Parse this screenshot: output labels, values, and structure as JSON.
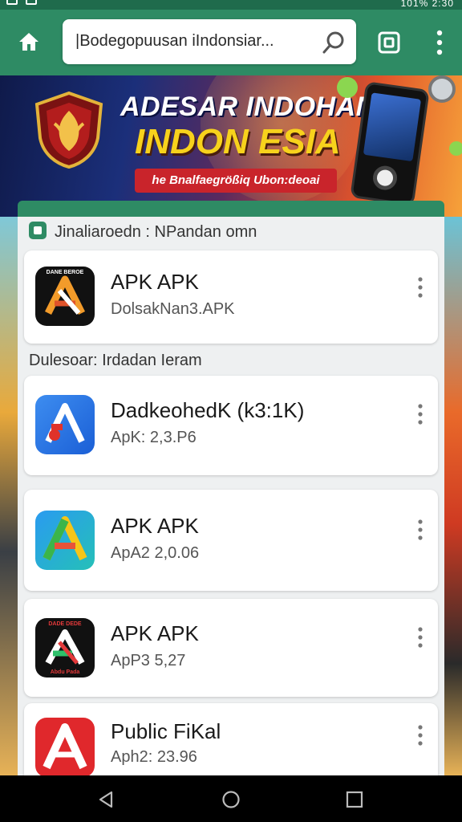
{
  "status_bar": {
    "right_text": "101% 2:30"
  },
  "browser": {
    "url_text": "|Bodegopuusan iIndonsiar..."
  },
  "banner": {
    "title_line1": "ADESAR INDOHAN",
    "title_line2": "INDON ESIA",
    "subtitle": "he Bnalfaegrößiq Ubon:deoai"
  },
  "sections": [
    {
      "title": "Jinaliaroedn :  NPandan omn"
    },
    {
      "title": "Dulesoar: Irdadan Ieram"
    }
  ],
  "apps": [
    {
      "name": "APK APK",
      "meta": "DolsakNan3.APK",
      "icon": "dark-apk-logo-icon"
    },
    {
      "name": "DadkeohedK (k3:1K)",
      "meta": "ApK: 2,3.P6",
      "icon": "blue-apk-logo-icon"
    },
    {
      "name": "APK APK",
      "meta": "ApA2 2,0.06",
      "icon": "gradient-apk-logo-icon"
    },
    {
      "name": "APK APK",
      "meta": "ApP3 5,27",
      "icon": "dark-apk-logo-icon"
    },
    {
      "name": "Public FiKal",
      "meta": "Aph2: 23.96",
      "icon": "red-apk-logo-icon"
    }
  ],
  "icon_labels": {
    "app1": "DANE BEROE",
    "app4_top": "DADE DEDE",
    "app4_bottom": "Abdu Pada"
  },
  "colors": {
    "toolbar": "#2e8b64",
    "accent_yellow": "#f7d21c",
    "banner_red": "#c9242b"
  }
}
